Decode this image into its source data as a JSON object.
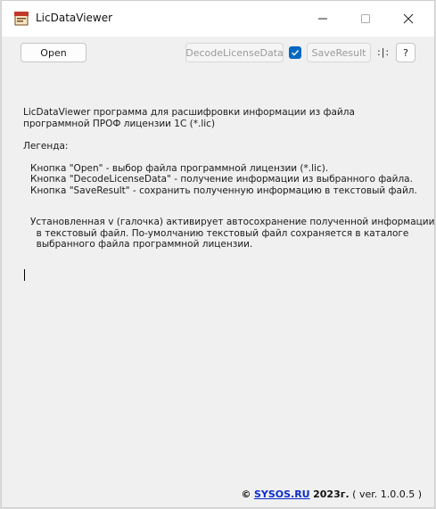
{
  "window": {
    "title": "LicDataViewer"
  },
  "toolbar": {
    "open_label": "Open",
    "decode_label": "DecodeLicenseData",
    "saveresult_label": "SaveResult",
    "autosave_checked": true,
    "splitter_label": ":|:",
    "help_label": "?"
  },
  "body": {
    "intro": "LicDataViewer программа для расшифровки информации из файла программной ПРОФ лицензии 1С (*.lic)",
    "legend_title": "Легенда:",
    "legend_items": [
      "Кнопка \"Open\" - выбор файла программной лицензии (*.lic).",
      "Кнопка \"DecodeLicenseData\" - получение информации из выбранного файла.",
      "Кнопка \"SaveResult\" - сохранить полученную информацию в текстовый файл."
    ],
    "note_lines": [
      "Установленная v (галочка) активирует автосохранение полученной информации",
      "  в текстовый файл. По-умолчанию текстовый файл сохраняется в каталоге",
      "  выбранного файла программной лицензии."
    ]
  },
  "footer": {
    "copyright": "©",
    "site": "SYSOS.RU",
    "year": "2023г.",
    "version": "( ver. 1.0.0.5 )"
  },
  "colors": {
    "accent": "#0067c0",
    "link": "#0a2dcc"
  }
}
